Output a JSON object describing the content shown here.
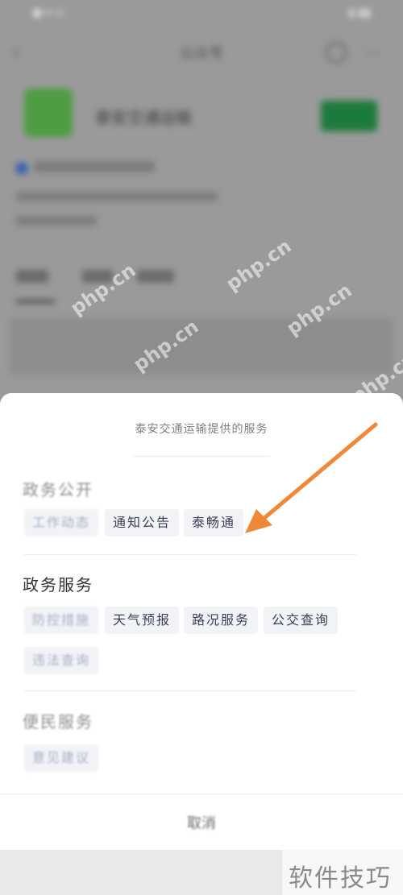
{
  "background": {
    "account_name": "泰安交通运输",
    "page_title": "公众号"
  },
  "sheet": {
    "title": "泰安交通运输提供的服务",
    "sections": [
      {
        "title": "政务公开",
        "items": [
          "工作动态",
          "通知公告",
          "泰畅通"
        ]
      },
      {
        "title": "政务服务",
        "items": [
          "防控措施",
          "天气预报",
          "路况服务",
          "公交查询",
          "违法查询"
        ]
      },
      {
        "title": "便民服务",
        "items": [
          "意见建议"
        ]
      }
    ],
    "cancel_label": "取消"
  },
  "watermark": "php.cn",
  "corner_brand": "软件技巧",
  "colors": {
    "arrow": "#f0883a",
    "sheet_bg": "#ffffff",
    "chip_bg": "#f2f3f7"
  }
}
